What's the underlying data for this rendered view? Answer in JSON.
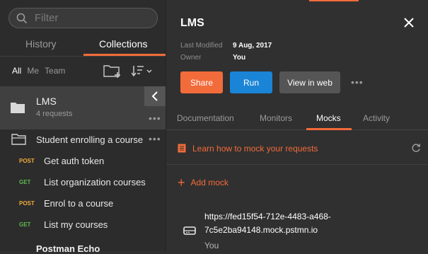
{
  "search": {
    "placeholder": "Filter"
  },
  "sidebar_tabs": {
    "history": "History",
    "collections": "Collections"
  },
  "filters": {
    "all": "All",
    "me": "Me",
    "team": "Team"
  },
  "selected_collection": {
    "name": "LMS",
    "count": "4 requests"
  },
  "folder": {
    "name": "Student enrolling a course"
  },
  "requests": [
    {
      "method": "POST",
      "name": "Get auth token"
    },
    {
      "method": "GET",
      "name": "List organization courses"
    },
    {
      "method": "POST",
      "name": "Enrol to a course"
    },
    {
      "method": "GET",
      "name": "List my courses"
    }
  ],
  "next_collection": "Postman Echo",
  "panel": {
    "title": "LMS",
    "last_modified_label": "Last Modified",
    "last_modified": "9 Aug, 2017",
    "owner_label": "Owner",
    "owner": "You",
    "share": "Share",
    "run": "Run",
    "view_in_web": "View in web",
    "more": "•••"
  },
  "panel_tabs": {
    "documentation": "Documentation",
    "monitors": "Monitors",
    "mocks": "Mocks",
    "activity": "Activity"
  },
  "mocks": {
    "learn_link": "Learn how to mock your requests",
    "add_mock": "Add mock",
    "items": [
      {
        "url_line1": "https://fed15f54-712e-4483-a468-",
        "url_line2": "7c5e2ba94148.mock.pstmn.io",
        "owner": "You"
      }
    ]
  },
  "colors": {
    "accent": "#f26b3a",
    "run": "#1a84d6",
    "get": "#5fb84e",
    "post": "#f2a93b"
  }
}
